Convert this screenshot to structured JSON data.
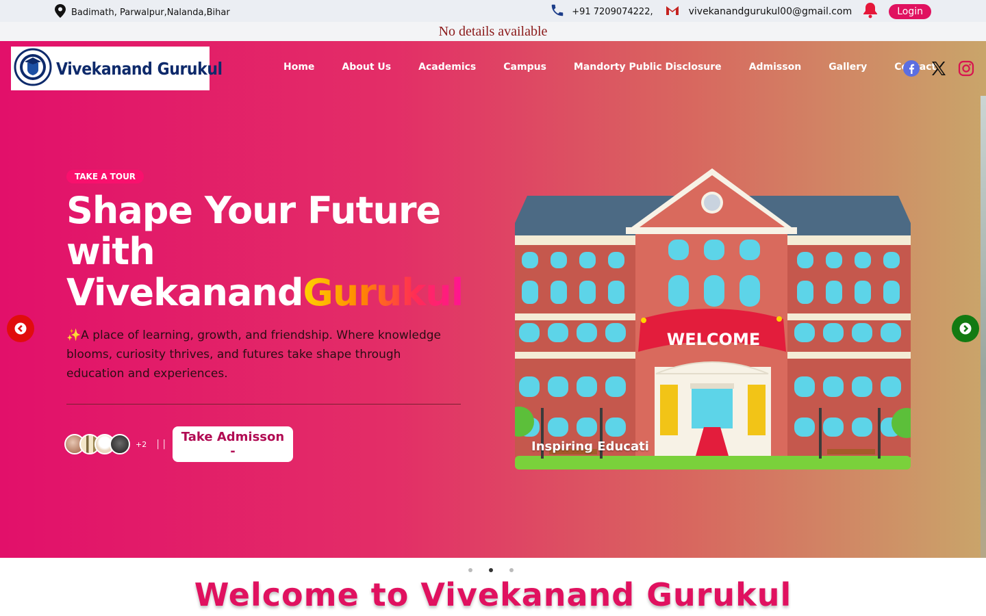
{
  "topbar": {
    "address": "Badimath, Parwalpur,Nalanda,Bihar",
    "phone": "+91 7209074222,",
    "email": "vivekanandgurukul00@gmail.com",
    "login_label": "Login",
    "icons": [
      "location-pin-icon",
      "phone-icon",
      "gmail-icon",
      "bell-icon"
    ]
  },
  "notice": "No details available",
  "brand": {
    "name": "Vivekanand Gurukul"
  },
  "nav": {
    "items": [
      "Home",
      "About Us",
      "Academics",
      "Campus",
      "Mandorty Public Disclosure",
      "Admisson",
      "Gallery",
      "Contact"
    ],
    "social": [
      "facebook-icon",
      "x-icon",
      "instagram-icon"
    ]
  },
  "hero": {
    "badge": "TAKE A TOUR",
    "title_line1": "Shape Your Future",
    "title_line2": "with",
    "title_line3_plain": "Vivekanand",
    "title_line3_grad": "Gurukul",
    "description": "✨A place of learning, growth, and friendship. Where knowledge blooms, curiosity thrives, and futures take shape through education and experiences.",
    "avatars_more": "+2",
    "separator": "| |",
    "cta_label": "Take Admisson -",
    "illustration_banner": "WELCOME",
    "illustration_caption": "Inspiring Educati"
  },
  "carousel": {
    "slides": 3,
    "active": 2
  },
  "colors": {
    "brand_pink": "#e0115f",
    "navy": "#0e2a6b",
    "prev_arrow": "#e00d0d",
    "next_arrow": "#137a12"
  },
  "welcome_heading": "Welcome to Vivekanand Gurukul"
}
